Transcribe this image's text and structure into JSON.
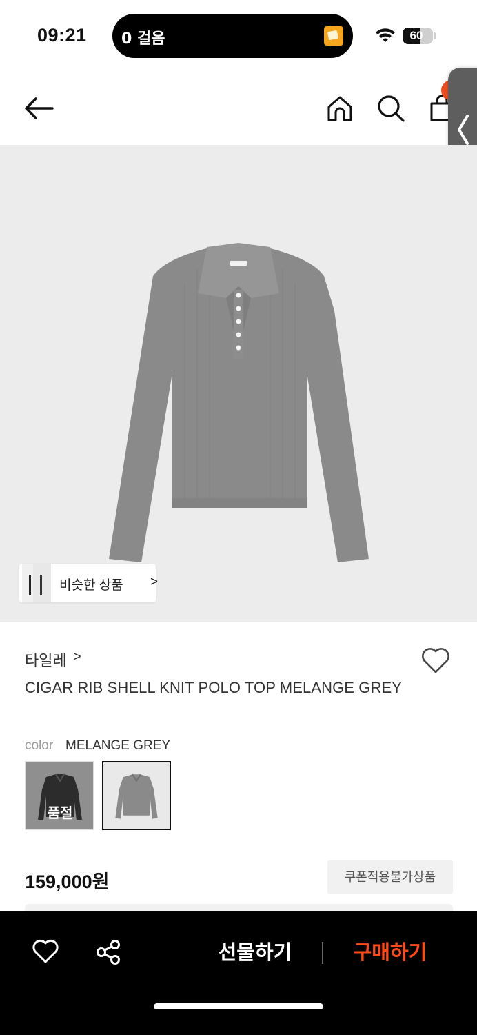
{
  "status_bar": {
    "time": "09:21",
    "activity": "0 걸음",
    "battery_level": "60",
    "battery_percent": 60
  },
  "similar": {
    "label": "비슷한 상품",
    "chevron": ">"
  },
  "product": {
    "brand": "타일레",
    "brand_chevron": ">",
    "title": "CIGAR RIB SHELL KNIT POLO TOP MELANGE GREY",
    "color_label": "color",
    "color_value": "MELANGE GREY",
    "swatches": [
      {
        "name": "black",
        "soldout_label": "품절"
      },
      {
        "name": "melange-grey",
        "selected": true
      }
    ],
    "price": "159,000원",
    "coupon_badge": "쿠폰적용불가상품"
  },
  "bottom_bar": {
    "gift_label": "선물하기",
    "buy_label": "구매하기",
    "buy_color": "#ff4a17"
  },
  "colors": {
    "accent": "#ee4d1f",
    "hero_background": "#ececec",
    "sweater": "#8a8a8a"
  }
}
